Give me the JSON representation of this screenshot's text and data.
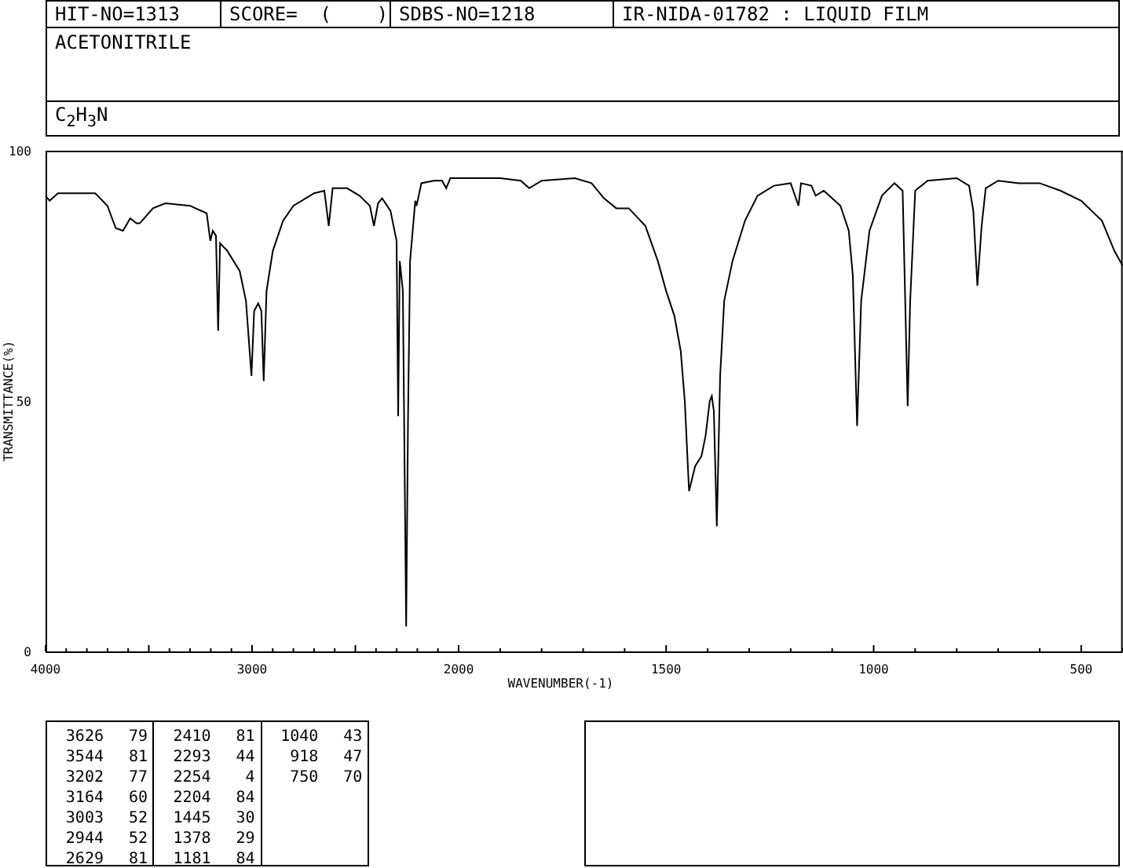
{
  "header": {
    "hit_no": "HIT-NO=1313",
    "score": "SCORE=  (    )",
    "sdbs_no": "SDBS-NO=1218",
    "method": "IR-NIDA-01782 : LIQUID FILM",
    "compound_name": "ACETONITRILE",
    "formula": "C$_{2}$H$_{3}$N"
  },
  "spectrum": {
    "high_range": {
      "chart_data": {
        "type": "line",
        "ylabel": "TRANSMITTANCE(%)",
        "xlim": [
          4000,
          2000
        ],
        "ylim": [
          0,
          100
        ],
        "xticks": [
          4000,
          3000
        ],
        "yticks": [
          0,
          50,
          100
        ],
        "x": [
          4000,
          3980,
          3940,
          3760,
          3700,
          3660,
          3625,
          3590,
          3560,
          3544,
          3480,
          3420,
          3300,
          3220,
          3202,
          3190,
          3175,
          3164,
          3155,
          3120,
          3060,
          3030,
          3003,
          2990,
          2970,
          2955,
          2944,
          2930,
          2900,
          2850,
          2800,
          2700,
          2650,
          2629,
          2610,
          2540,
          2480,
          2430,
          2410,
          2390,
          2370,
          2330,
          2300,
          2293,
          2285,
          2270,
          2254,
          2245,
          2235,
          2210,
          2204,
          2180,
          2120,
          2080,
          2060,
          2040,
          2000
        ],
        "series": [
          {
            "color": "#000000",
            "values": [
              91,
              90,
              91.5,
              91.5,
              89,
              84.5,
              84,
              86.5,
              85.5,
              85.5,
              88.5,
              89.5,
              89,
              87.5,
              82,
              84,
              83,
              64,
              81.5,
              80,
              76,
              70,
              55,
              68,
              69.5,
              68,
              54,
              72,
              80,
              86,
              89,
              91.5,
              92,
              85,
              92.5,
              92.5,
              91,
              89,
              85,
              89.5,
              90.5,
              88,
              82,
              47,
              78,
              72,
              5,
              47,
              78,
              90,
              89,
              93.5,
              94,
              94,
              92.5,
              94.5,
              94.5
            ]
          }
        ]
      }
    },
    "low_range": {
      "chart_data": {
        "type": "line",
        "xlabel": "WAVENUMBER(-1)",
        "xlim": [
          2000,
          400
        ],
        "ylim": [
          0,
          100
        ],
        "xticks": [
          2000,
          1500,
          1000,
          500
        ],
        "x": [
          2000,
          1900,
          1850,
          1830,
          1800,
          1720,
          1680,
          1650,
          1620,
          1590,
          1550,
          1520,
          1500,
          1480,
          1465,
          1455,
          1445,
          1430,
          1415,
          1405,
          1395,
          1390,
          1385,
          1378,
          1370,
          1360,
          1340,
          1310,
          1280,
          1240,
          1200,
          1181,
          1175,
          1150,
          1140,
          1120,
          1080,
          1060,
          1050,
          1040,
          1030,
          1010,
          980,
          950,
          930,
          918,
          912,
          900,
          870,
          800,
          770,
          760,
          750,
          740,
          730,
          700,
          650,
          600,
          550,
          500,
          450,
          420,
          400
        ],
        "series": [
          {
            "color": "#000000",
            "values": [
              94.5,
              94.5,
              94,
              92.5,
              94,
              94.5,
              93.5,
              90.5,
              88.5,
              88.5,
              85,
              78,
              72,
              67,
              60,
              50,
              32,
              37,
              39,
              43,
              50,
              51,
              48,
              25,
              55,
              70,
              78,
              86,
              91,
              93,
              93.5,
              89,
              93.5,
              93,
              91,
              92,
              89,
              84,
              75,
              45,
              70,
              84,
              91,
              93.5,
              92,
              49,
              70,
              92,
              94,
              94.5,
              93,
              88,
              73,
              85,
              92.5,
              94,
              93.5,
              93.5,
              92,
              90,
              86,
              80,
              77
            ]
          }
        ]
      }
    }
  },
  "peak_table": [
    {
      "wavenumber": "3626",
      "transmittance": "79"
    },
    {
      "wavenumber": "3544",
      "transmittance": "81"
    },
    {
      "wavenumber": "3202",
      "transmittance": "77"
    },
    {
      "wavenumber": "3164",
      "transmittance": "60"
    },
    {
      "wavenumber": "3003",
      "transmittance": "52"
    },
    {
      "wavenumber": "2944",
      "transmittance": "52"
    },
    {
      "wavenumber": "2629",
      "transmittance": "81"
    },
    {
      "wavenumber": "2410",
      "transmittance": "81"
    },
    {
      "wavenumber": "2293",
      "transmittance": "44"
    },
    {
      "wavenumber": "2254",
      "transmittance": "4"
    },
    {
      "wavenumber": "2204",
      "transmittance": "84"
    },
    {
      "wavenumber": "1445",
      "transmittance": "30"
    },
    {
      "wavenumber": "1378",
      "transmittance": "29"
    },
    {
      "wavenumber": "1181",
      "transmittance": "84"
    },
    {
      "wavenumber": "1040",
      "transmittance": "43"
    },
    {
      "wavenumber": "918",
      "transmittance": "47"
    },
    {
      "wavenumber": "750",
      "transmittance": "70"
    }
  ]
}
